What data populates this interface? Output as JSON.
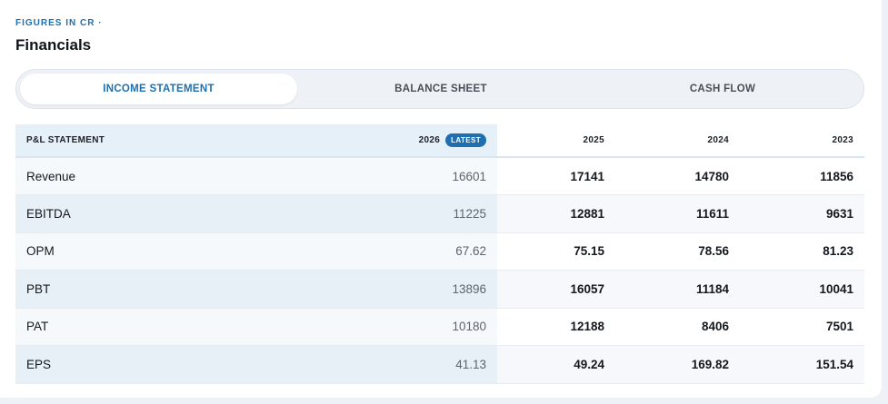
{
  "header": {
    "eyebrow": "FIGURES IN CR ·",
    "title": "Financials"
  },
  "tabs": [
    {
      "label": "INCOME STATEMENT",
      "active": true
    },
    {
      "label": "BALANCE SHEET",
      "active": false
    },
    {
      "label": "CASH FLOW",
      "active": false
    }
  ],
  "table": {
    "label_header": "P&L STATEMENT",
    "latest_year": "2026",
    "latest_badge": "LATEST",
    "years": [
      "2025",
      "2024",
      "2023"
    ],
    "rows": [
      {
        "metric": "Revenue",
        "latest": "16601",
        "values": [
          "17141",
          "14780",
          "11856"
        ]
      },
      {
        "metric": "EBITDA",
        "latest": "11225",
        "values": [
          "12881",
          "11611",
          "9631"
        ]
      },
      {
        "metric": "OPM",
        "latest": "67.62",
        "values": [
          "75.15",
          "78.56",
          "81.23"
        ]
      },
      {
        "metric": "PBT",
        "latest": "13896",
        "values": [
          "16057",
          "11184",
          "10041"
        ]
      },
      {
        "metric": "PAT",
        "latest": "10180",
        "values": [
          "12188",
          "8406",
          "7501"
        ]
      },
      {
        "metric": "EPS",
        "latest": "41.13",
        "values": [
          "49.24",
          "169.82",
          "151.54"
        ]
      }
    ]
  },
  "colors": {
    "accent": "#1f6fb0",
    "latest_column_bg": "#e6f0f9"
  }
}
